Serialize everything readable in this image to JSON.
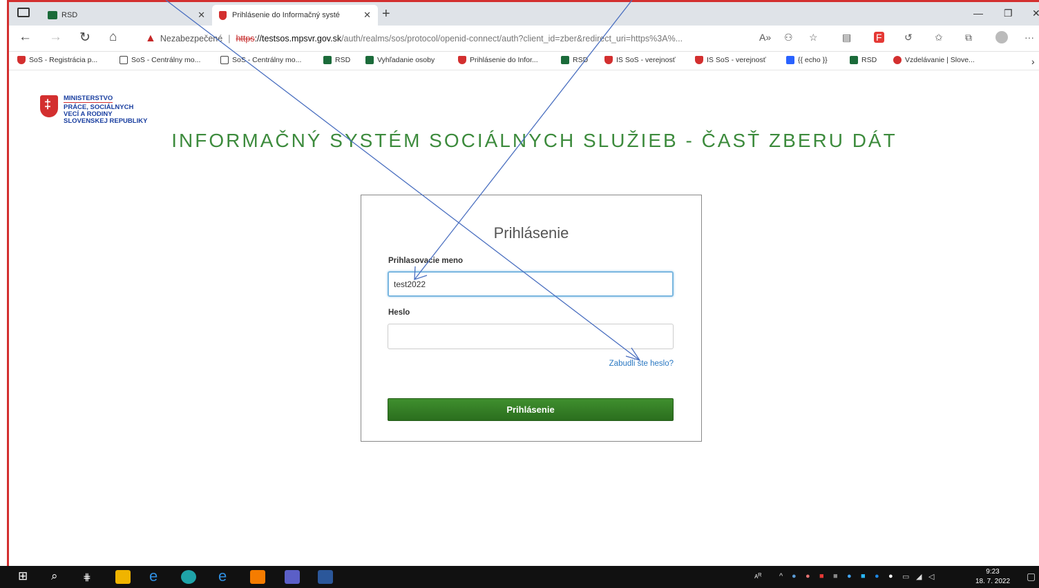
{
  "browser": {
    "tabs": [
      {
        "label": "RSD",
        "icon": "rsd-icon"
      },
      {
        "label": "Prihlásenie do Informačný systé",
        "icon": "shield-favicon"
      }
    ],
    "address": {
      "security_label": "Nezabezpečené",
      "scheme": "https",
      "host_prefix": "://testsos.mpsvr.gov.sk",
      "path": "/auth/realms/sos/protocol/openid-connect/auth?client_id=zber&redirect_uri=https%3A%..."
    },
    "bookmarks": [
      {
        "label": "SoS - Registrácia p...",
        "icon": "shield-icon",
        "color": "#d32f2f"
      },
      {
        "label": "SoS - Centrálny mo...",
        "icon": "page-icon",
        "color": "#ffffff"
      },
      {
        "label": "SoS - Centrálny mo...",
        "icon": "page-icon",
        "color": "#ffffff"
      },
      {
        "label": "RSD",
        "icon": "rsd-icon",
        "color": "#1b6b3a"
      },
      {
        "label": "Vyhľadanie osoby",
        "icon": "rsd-icon",
        "color": "#1b6b3a"
      },
      {
        "label": "Prihlásenie do Infor...",
        "icon": "shield-icon",
        "color": "#d32f2f"
      },
      {
        "label": "RSD",
        "icon": "rsd-icon",
        "color": "#1b6b3a"
      },
      {
        "label": "IS SoS - verejnosť",
        "icon": "shield-icon",
        "color": "#d32f2f"
      },
      {
        "label": "IS SoS - verejnosť",
        "icon": "shield-icon",
        "color": "#d32f2f"
      },
      {
        "label": "{{ echo }}",
        "icon": "grid-icon",
        "color": "#2962ff"
      },
      {
        "label": "RSD",
        "icon": "rsd-icon",
        "color": "#1b6b3a"
      },
      {
        "label": "Vzdelávanie | Slove...",
        "icon": "circle-icon",
        "color": "#d32f2f"
      }
    ]
  },
  "page": {
    "logo": {
      "line1": "MINISTERSTVO",
      "line2": "PRÁCE, SOCIÁLNYCH",
      "line3": "VECÍ A RODINY",
      "line4": "SLOVENSKEJ REPUBLIKY"
    },
    "heading": "INFORMAČNÝ SYSTÉM SOCIÁLNYCH SLUŽIEB - ČASŤ ZBERU DÁT",
    "login": {
      "title": "Prihlásenie",
      "username_label": "Prihlasovacie meno",
      "username_value": "test2022",
      "password_label": "Heslo",
      "password_value": "",
      "forgot_link": "Zabudli ste heslo?",
      "submit_label": "Prihlásenie"
    }
  },
  "taskbar": {
    "time": "9:23",
    "date": "18. 7. 2022",
    "lang": "ᴀᴿ"
  },
  "colors": {
    "accent_green": "#3d8b3d",
    "button_green": "#2b6e1e",
    "warning_red": "#c62828",
    "arrow_blue": "#4a6fc0"
  }
}
